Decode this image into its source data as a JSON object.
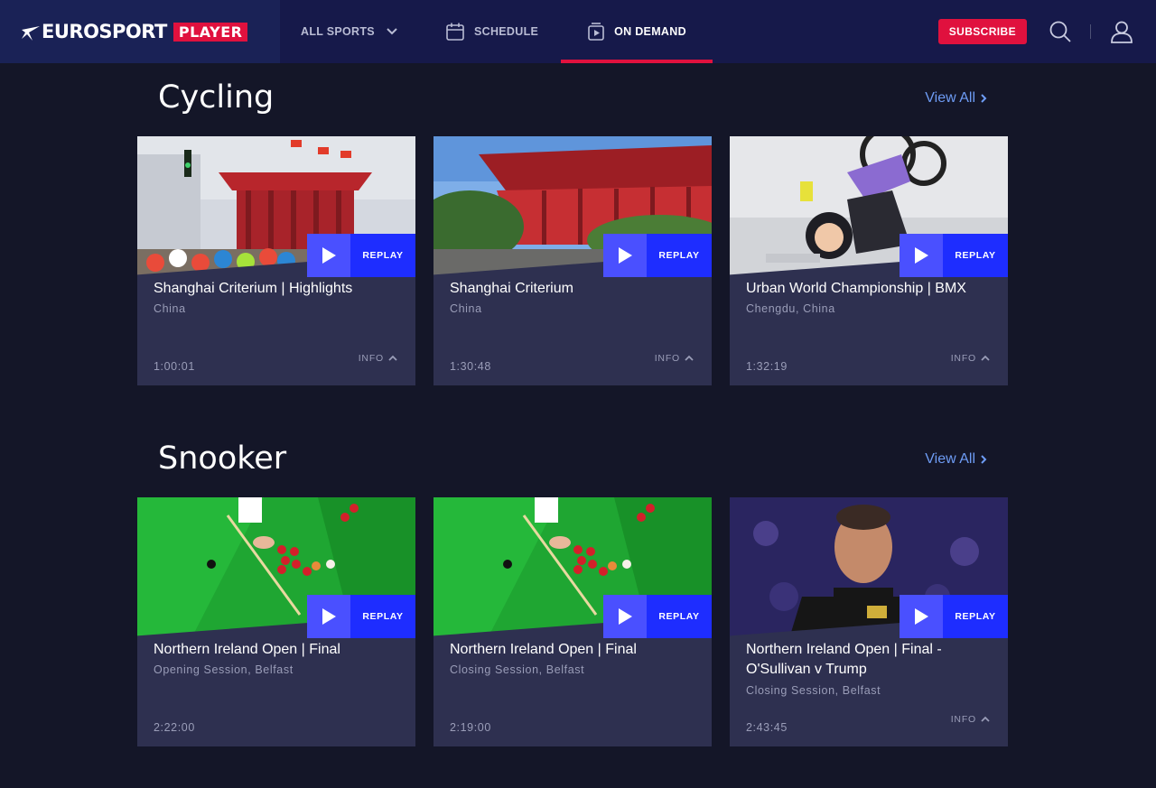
{
  "header": {
    "brand_name": "EUROSPORT",
    "brand_badge": "PLAYER",
    "nav": [
      {
        "label": "ALL SPORTS",
        "icon": "chevron-down-icon"
      },
      {
        "label": "SCHEDULE",
        "icon": "calendar-icon"
      },
      {
        "label": "ON DEMAND",
        "icon": "video-icon",
        "active": true
      }
    ],
    "subscribe_label": "SUBSCRIBE",
    "search_icon": "search-icon",
    "user_icon": "user-icon",
    "accent_color": "#e0113e"
  },
  "sections": [
    {
      "title": "Cycling",
      "view_all": "View All",
      "cards": [
        {
          "title": "Shanghai Criterium | Highlights",
          "subtitle": "China",
          "duration": "1:00:01",
          "replay": "REPLAY",
          "info": "INFO"
        },
        {
          "title": "Shanghai Criterium",
          "subtitle": "China",
          "duration": "1:30:48",
          "replay": "REPLAY",
          "info": "INFO"
        },
        {
          "title": "Urban World Championship | BMX",
          "subtitle": "Chengdu, China",
          "duration": "1:32:19",
          "replay": "REPLAY",
          "info": "INFO"
        }
      ]
    },
    {
      "title": "Snooker",
      "view_all": "View All",
      "cards": [
        {
          "title": "Northern Ireland Open | Final",
          "subtitle": "Opening Session, Belfast",
          "duration": "2:22:00",
          "replay": "REPLAY",
          "info": ""
        },
        {
          "title": "Northern Ireland Open | Final",
          "subtitle": "Closing Session, Belfast",
          "duration": "2:19:00",
          "replay": "REPLAY",
          "info": ""
        },
        {
          "title": "Northern Ireland Open | Final - O'Sullivan v Trump",
          "subtitle": "Closing Session, Belfast",
          "duration": "2:43:45",
          "replay": "REPLAY",
          "info": "INFO"
        }
      ]
    }
  ]
}
